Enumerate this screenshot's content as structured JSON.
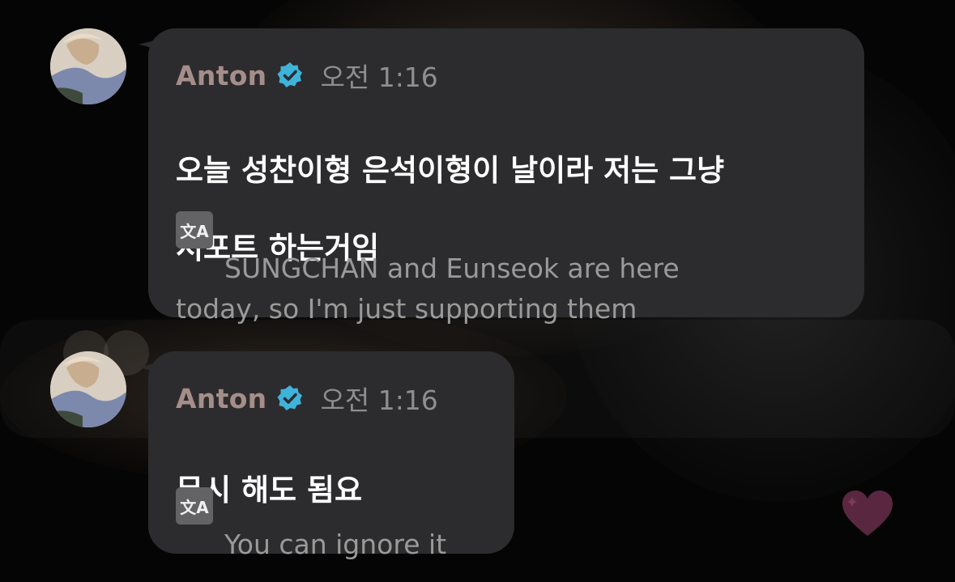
{
  "messages": [
    {
      "author": "Anton",
      "time": "오전 1:16",
      "original_line1": "오늘 성찬이형 은석이형이 날이라 저는 그냥",
      "original_line2": "서포트 하는거임",
      "translation_line1": "SUNGCHAN and Eunseok are here",
      "translation_line2": "today, so I'm just supporting them"
    },
    {
      "author": "Anton",
      "time": "오전 1:16",
      "original_line1": "무시 해도 됨요",
      "translation_line1": "You can ignore it"
    }
  ],
  "icons": {
    "verified": "verified-badge-icon",
    "translate": "translate-icon",
    "heart": "heart-icon"
  },
  "translate_glyph": "文A",
  "colors": {
    "bubble": "#2c2c2e",
    "author": "#a58e8a",
    "verified": "#3fb3d9",
    "heart": "#5a2740"
  }
}
